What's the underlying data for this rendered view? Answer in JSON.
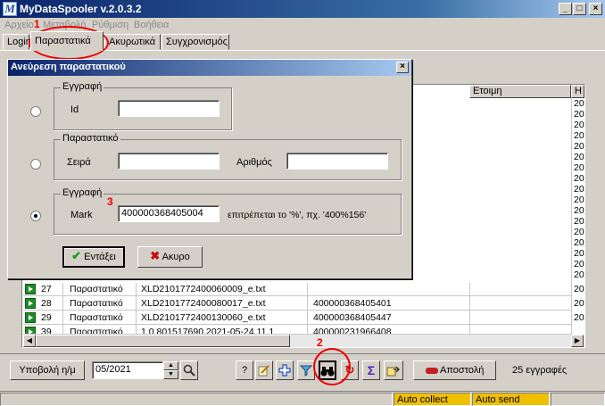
{
  "window": {
    "title": "MyDataSpooler v.2.0.3.2",
    "icon_glyph": "M"
  },
  "menu": [
    "Αρχείο",
    "Μεταβολή",
    "Ρύθμιση",
    "Βοήθεια"
  ],
  "tabs": [
    {
      "label": "Login"
    },
    {
      "label": "Παραστατικά",
      "active": true
    },
    {
      "label": "Ακυρωτικά"
    },
    {
      "label": "Συγχρονισμός"
    }
  ],
  "annotations": {
    "n1": "1",
    "n2": "2",
    "n3": "3"
  },
  "grid": {
    "headers": {
      "col_status": "Ετοιμη",
      "col_last": "Η"
    },
    "right_edge_values": [
      "20",
      "20",
      "20",
      "20",
      "20",
      "20",
      "20",
      "20",
      "20",
      "20",
      "20",
      "20",
      "20",
      "20",
      "20",
      "20",
      "20"
    ],
    "rows": [
      {
        "num": "27",
        "type": "Παραστατικό",
        "file": "XLD2101772400060009_e.txt",
        "mark": "",
        "last": "20"
      },
      {
        "num": "28",
        "type": "Παραστατικό",
        "file": "XLD2101772400080017_e.txt",
        "mark": "400000368405401",
        "last": "20"
      },
      {
        "num": "29",
        "type": "Παραστατικό",
        "file": "XLD2101772400130060_e.txt",
        "mark": "400000368405447",
        "last": "20"
      },
      {
        "num": "39",
        "type": "Παραστατικό",
        "file": "1.0.801517690.2021-05-24.11.1",
        "mark": "400000231966408",
        "last": "20"
      }
    ]
  },
  "dialog": {
    "title": "Ανεύρεση παραστατικού",
    "group1": {
      "label": "Εγγραφή",
      "field_label": "Id",
      "value": ""
    },
    "group2": {
      "label": "Παραστατικό",
      "series_label": "Σειρά",
      "series_value": "",
      "number_label": "Αριθμός",
      "number_value": ""
    },
    "group3": {
      "label": "Εγγραφή",
      "mark_label": "Mark",
      "mark_value": "400000368405004",
      "hint": "επιτρέπεται το '%', πχ. '400%156'"
    },
    "selected_option": 3,
    "ok_label": "Εντάξει",
    "cancel_label": "Ακυρο"
  },
  "toolbar": {
    "submit_label": "Υποβολή η/μ",
    "period_value": "05/2021",
    "help_label": "?",
    "send_label": "Αποστολή",
    "records_text": "25 εγγραφές",
    "icons": [
      "search-icon",
      "help-icon",
      "edit-icon",
      "add-icon",
      "filter-icon",
      "binoculars-icon",
      "refresh-icon",
      "sum-icon",
      "export-icon",
      "send-icon"
    ]
  },
  "status": {
    "auto_collect": "Auto collect",
    "auto_send": "Auto send"
  }
}
